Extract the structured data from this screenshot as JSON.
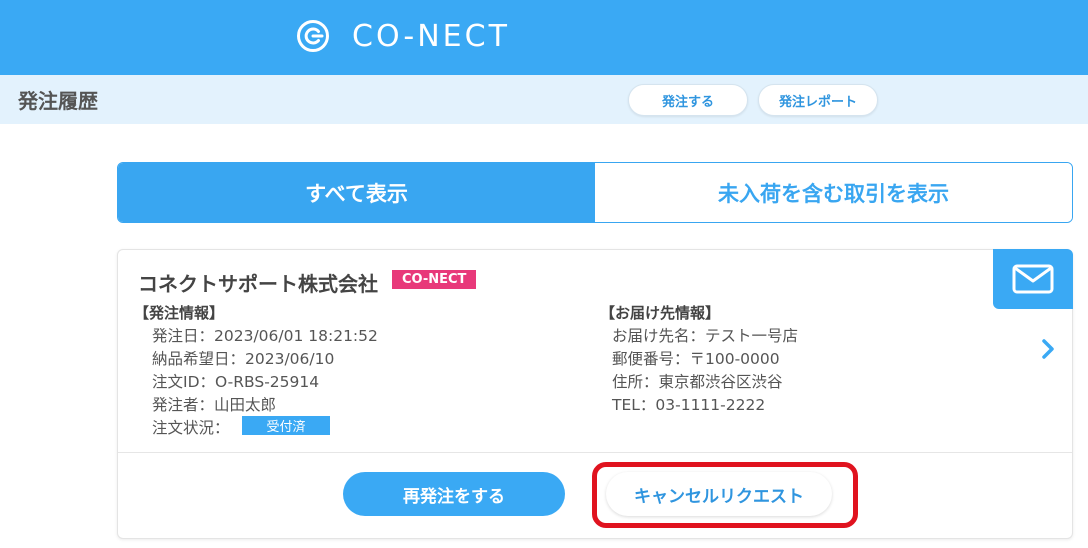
{
  "header": {
    "logo_text": "CO-NECT",
    "logo_icon": "conect-logo-icon",
    "brand_color": "#3aa9f4"
  },
  "subheader": {
    "title": "発注履歴",
    "order_button": "発注する",
    "report_button": "発注レポート"
  },
  "tabs": [
    {
      "label": "すべて表示",
      "active": true
    },
    {
      "label": "未入荷を含む取引を表示",
      "active": false
    }
  ],
  "order_card": {
    "company": "コネクトサポート株式会社",
    "brand_badge": "CO-NECT",
    "brand_badge_color": "#e8397a",
    "mail_icon": "mail-icon",
    "order_info": {
      "heading": "【発注情報】",
      "order_date": "発注日：2023/06/01 18:21:52",
      "requested_delivery": "納品希望日：2023/06/10",
      "order_id": "注文ID：O-RBS-25914",
      "orderer": "発注者：山田太郎",
      "status_label": "注文状況：",
      "status_value": "受付済"
    },
    "delivery_info": {
      "heading": "【お届け先情報】",
      "destination": "お届け先名：テスト一号店",
      "postal_code": "郵便番号：〒100-0000",
      "address": "住所：東京都渋谷区渋谷",
      "tel": "TEL：03-1111-2222"
    },
    "reorder_button": "再発注をする",
    "cancel_button": "キャンセルリクエスト",
    "highlight_color": "#e0131f"
  }
}
